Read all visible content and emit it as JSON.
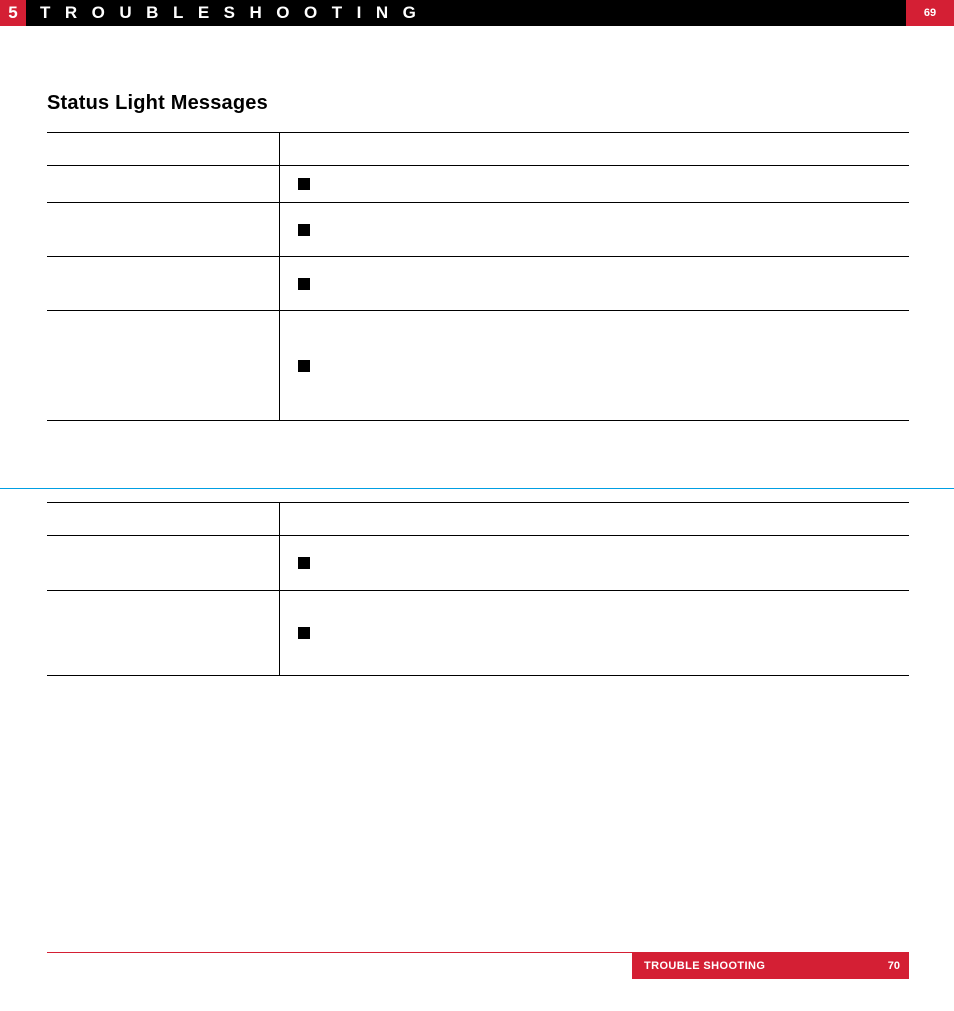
{
  "header": {
    "chapter_number": "5",
    "chapter_title": "TROUBLESHOOTING",
    "page_number": "69"
  },
  "section_title": "Status Light Messages",
  "table1": {
    "header_left": "",
    "header_right": "",
    "rows": [
      {
        "left": "",
        "right_bullet": "■",
        "right_text": "",
        "height": 37
      },
      {
        "left": "",
        "right_bullet": "■",
        "right_text": "",
        "height": 54
      },
      {
        "left": "",
        "right_bullet": "■",
        "right_text": "",
        "height": 54
      },
      {
        "left": "",
        "right_bullet": "■",
        "right_text": "",
        "height": 110
      }
    ]
  },
  "table2": {
    "header_left": "",
    "header_right": "",
    "rows": [
      {
        "left": "",
        "right_bullet": "■",
        "right_text": "",
        "height": 55
      },
      {
        "left": "",
        "right_bullet": "■",
        "right_text": "",
        "height": 85
      }
    ]
  },
  "footer": {
    "label": "TROUBLE SHOOTING",
    "page_number": "70"
  }
}
